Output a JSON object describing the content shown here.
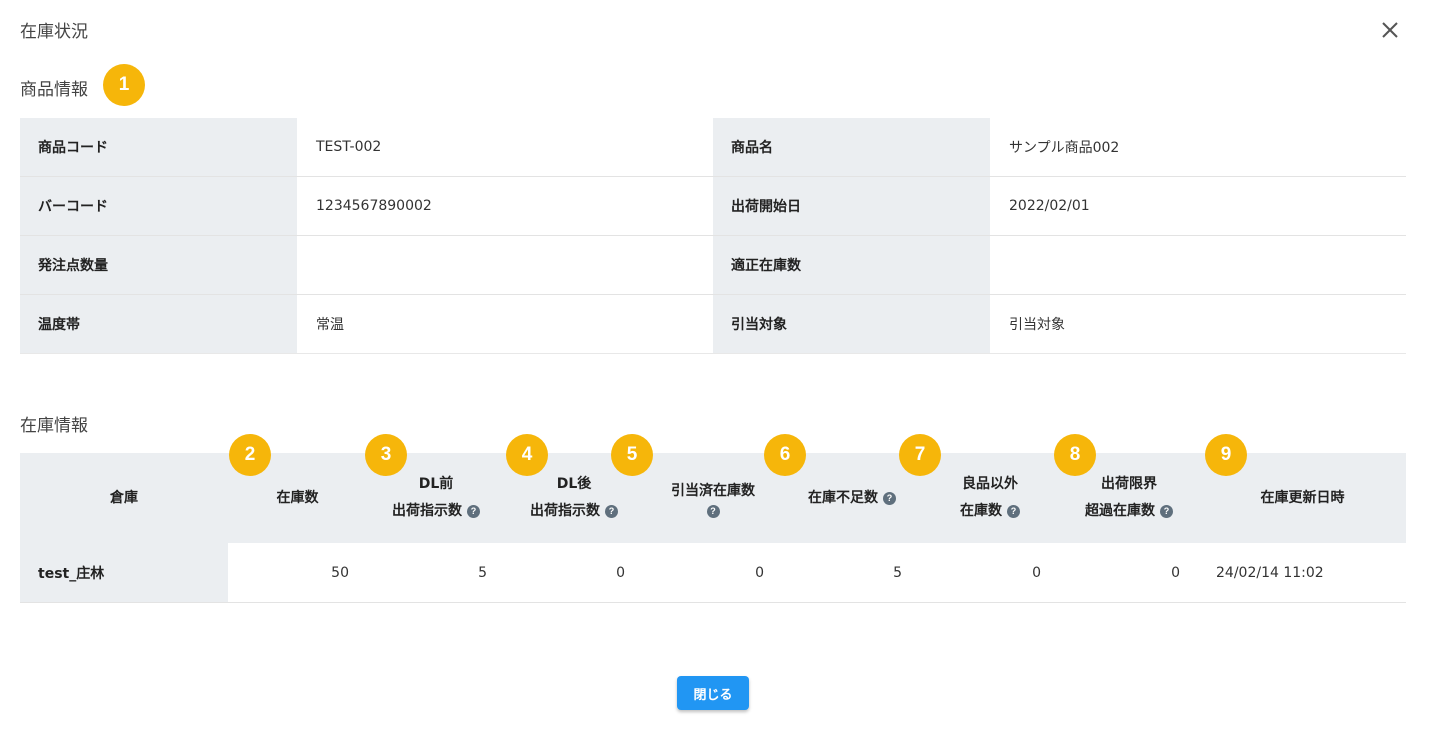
{
  "dialog": {
    "title": "在庫状況",
    "close_icon": "close-icon"
  },
  "product_section": {
    "title": "商品情報",
    "badge": "1",
    "rows": [
      {
        "label1": "商品コード",
        "value1": "TEST-002",
        "label2": "商品名",
        "value2": "サンプル商品002"
      },
      {
        "label1": "バーコード",
        "value1": "1234567890002",
        "label2": "出荷開始日",
        "value2": "2022/02/01"
      },
      {
        "label1": "発注点数量",
        "value1": "",
        "label2": "適正在庫数",
        "value2": ""
      },
      {
        "label1": "温度帯",
        "value1": "常温",
        "label2": "引当対象",
        "value2": "引当対象"
      }
    ]
  },
  "stock_section": {
    "title": "在庫情報",
    "badges": [
      "2",
      "3",
      "4",
      "5",
      "6",
      "7",
      "8",
      "9"
    ],
    "headers": {
      "warehouse": "倉庫",
      "stock_qty": "在庫数",
      "dl_before_1": "DL前",
      "dl_before_2": "出荷指示数",
      "dl_after_1": "DL後",
      "dl_after_2": "出荷指示数",
      "allocated": "引当済在庫数",
      "shortage": "在庫不足数",
      "non_good_1": "良品以外",
      "non_good_2": "在庫数",
      "limit_over_1": "出荷限界",
      "limit_over_2": "超過在庫数",
      "updated_at": "在庫更新日時"
    },
    "help_icon": "?",
    "rows": [
      {
        "warehouse": "test_庄林",
        "stock_qty": "50",
        "dl_before": "5",
        "dl_after": "0",
        "allocated": "0",
        "shortage": "5",
        "non_good": "0",
        "limit_over": "0",
        "updated_at": "24/02/14 11:02"
      }
    ]
  },
  "footer": {
    "close_button": "閉じる"
  },
  "colors": {
    "badge": "#f6b60a",
    "primary_button": "#2196f3",
    "label_bg": "#ebeef1",
    "help_icon": "#5f6f7d"
  }
}
